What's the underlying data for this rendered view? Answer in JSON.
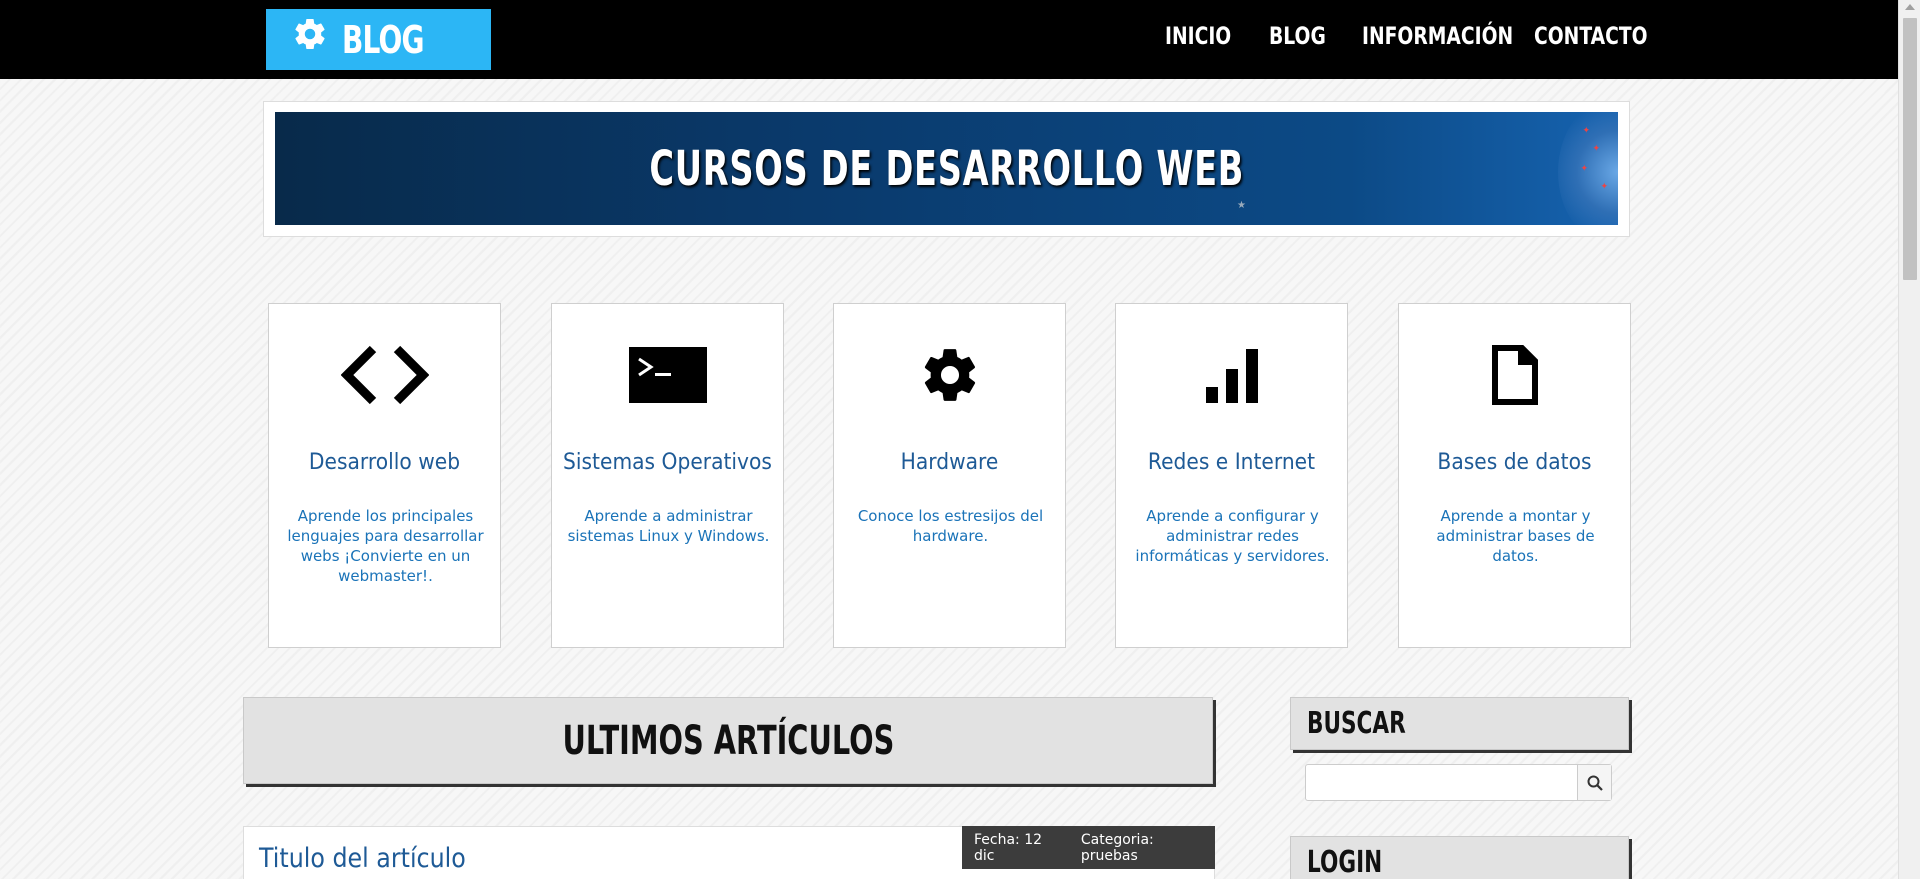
{
  "navbar": {
    "logo_text": "BLOG",
    "logo_color": "#2cb6f5",
    "items": [
      {
        "label": "INICIO"
      },
      {
        "label": "BLOG"
      },
      {
        "label": "INFORMACIÓN"
      },
      {
        "label": "CONTACTO"
      }
    ]
  },
  "banner": {
    "title": "CURSOS DE DESARROLLO WEB"
  },
  "categories": [
    {
      "icon": "code-icon",
      "title": "Desarrollo web",
      "description": "Aprende los principales lenguajes para desarrollar webs ¡Convierte en un webmaster!."
    },
    {
      "icon": "terminal-icon",
      "title": "Sistemas Operativos",
      "description": "Aprende a administrar sistemas Linux y Windows."
    },
    {
      "icon": "gear-icon",
      "title": "Hardware",
      "description": "Conoce los estresijos del hardware."
    },
    {
      "icon": "signal-bars-icon",
      "title": "Redes e Internet",
      "description": "Aprende a configurar y administrar redes informáticas y servidores."
    },
    {
      "icon": "document-icon",
      "title": "Bases de datos",
      "description": "Aprende a montar y administrar bases de datos."
    }
  ],
  "main": {
    "section_title": "ULTIMOS ARTÍCULOS",
    "article": {
      "title": "Titulo del artículo",
      "date": "Fecha: 12 dic",
      "category": "Categoria: pruebas"
    }
  },
  "sidebar": {
    "search_title": "BUSCAR",
    "search_value": "",
    "login_title": "LOGIN"
  }
}
